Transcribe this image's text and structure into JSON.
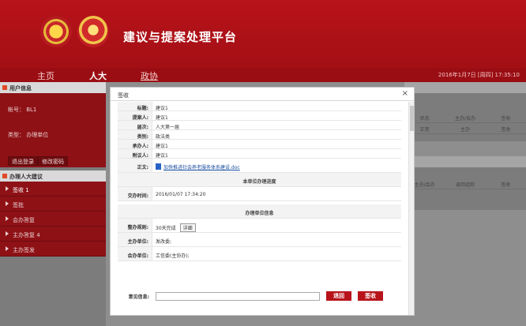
{
  "header": {
    "title": "建议与提案处理平台"
  },
  "nav": {
    "home": "主页",
    "renda": "人大",
    "zhengxie": "政协",
    "date": "2016年1月7日 [周四] 17:35:10"
  },
  "sidebar": {
    "user_panel_title": "用户信息",
    "account": "帐号：  BL1",
    "type": "类型：  办理单位",
    "logout_label": "退出登录",
    "change_pwd_label": "修改密码",
    "list_title": "办理人大建议",
    "items": [
      {
        "label": "签收 1"
      },
      {
        "label": "签批"
      },
      {
        "label": "会办答复"
      },
      {
        "label": "主办答复 4"
      },
      {
        "label": "主办签发"
      }
    ]
  },
  "right_table1": {
    "headers": [
      "状态",
      "主办/会办",
      "签收"
    ],
    "rows": [
      [
        "正常",
        "主办",
        "签收"
      ]
    ]
  },
  "right_table2": {
    "headers": [
      "主办/会办",
      "退回追踪",
      "签收"
    ]
  },
  "modal": {
    "title": "签收",
    "close": "×",
    "fields": [
      {
        "label": "标题:",
        "value": "建议1"
      },
      {
        "label": "提案人:",
        "value": "建议1"
      },
      {
        "label": "届次:",
        "value": "人大第一届"
      },
      {
        "label": "类别:",
        "value": "政法类"
      },
      {
        "label": "承办人:",
        "value": "建议1"
      },
      {
        "label": "附议人:",
        "value": "建议1"
      }
    ],
    "body_label": "正文:",
    "body_link": "加快推进社会养老服务体系建设.doc",
    "section1": "本单位办理进度",
    "assign_time_label": "交办时间:",
    "assign_time": "2016/01/07 17:34:20",
    "section2": "办理单位信息",
    "deadline_label": "整办规则:",
    "deadline": "30天完成",
    "detail_label": "详细",
    "host_label": "主办单位:",
    "host": "发改委;",
    "co_label": "会办单位:",
    "co": "工信委(主协办);",
    "opinion_label": "意见信息:",
    "opinion_value": "",
    "return_label": "退回",
    "sign_label": "签收"
  }
}
